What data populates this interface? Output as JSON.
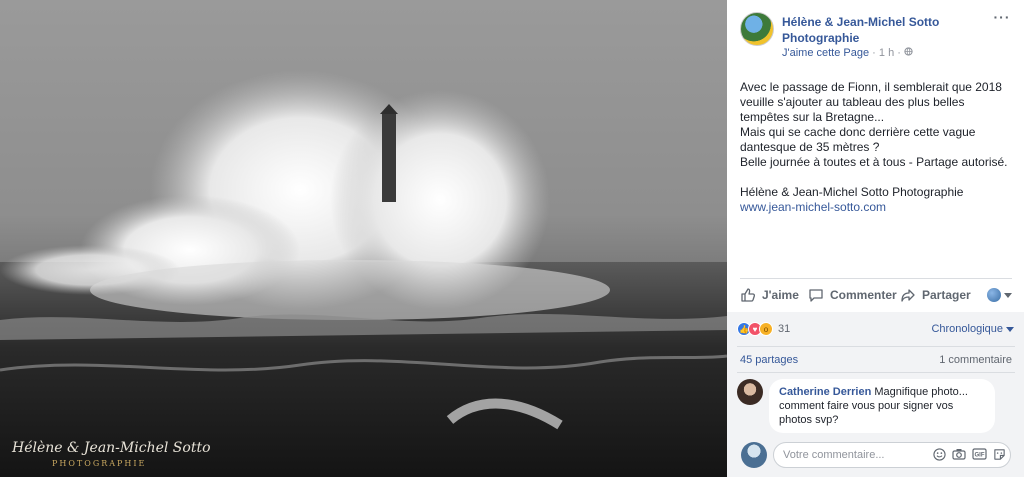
{
  "photo": {
    "watermark_main": "Hélène & Jean-Michel Sotto",
    "watermark_sub": "PHOTOGRAPHIE"
  },
  "post": {
    "page_name": "Hélène & Jean-Michel Sotto Photographie",
    "like_page": "J'aime cette Page",
    "separator": "·",
    "time": "1 h",
    "privacy_icon": "globe-icon",
    "more": "···",
    "text_lines": [
      "Avec le passage de Fionn, il semblerait que 2018",
      "veuille s'ajouter au tableau des plus belles",
      "tempêtes sur la Bretagne...",
      "Mais qui se cache donc derrière cette vague",
      "dantesque de 35 mètres ?",
      "Belle journée à toutes et à tous - Partage autorisé."
    ],
    "signature": "Hélène & Jean-Michel Sotto Photographie",
    "link": "www.jean-michel-sotto.com"
  },
  "actions": {
    "like": "J'aime",
    "comment": "Commenter",
    "share": "Partager"
  },
  "reactions": {
    "count": "31",
    "sort": "Chronologique",
    "types": [
      "like",
      "love",
      "wow"
    ]
  },
  "stats": {
    "shares": "45 partages",
    "comments": "1 commentaire"
  },
  "comment": {
    "author": "Catherine Derrien",
    "text": "Magnifique photo... comment faire vous pour signer vos photos svp?"
  },
  "composer": {
    "placeholder": "Votre commentaire...",
    "tool_icons": [
      "emoji-icon",
      "camera-icon",
      "gif-icon",
      "sticker-icon"
    ]
  },
  "colors": {
    "link": "#365899",
    "text": "#1d2129",
    "muted": "#90949c"
  }
}
